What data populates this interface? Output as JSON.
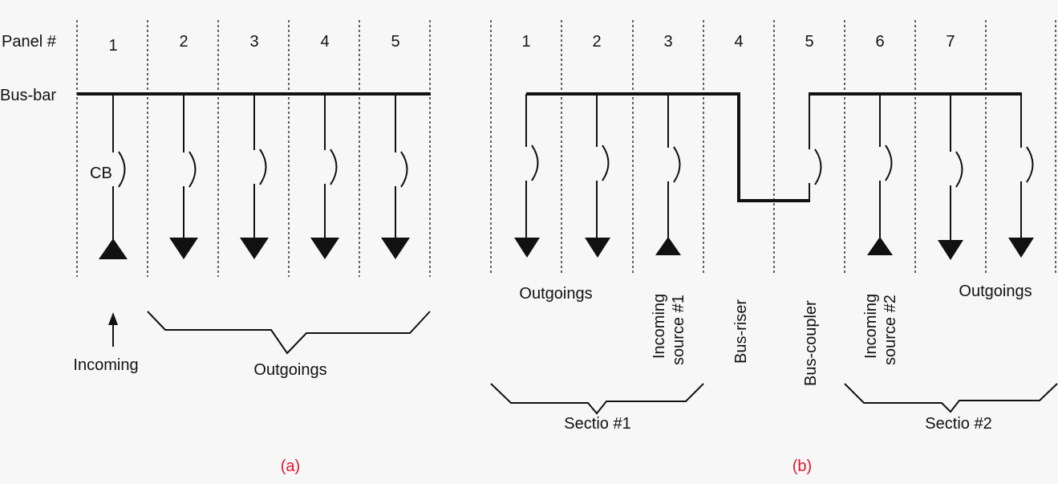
{
  "colors": {
    "ink": "#111111",
    "caption": "#e8132b",
    "background": "#f7f7f7"
  },
  "diagram_a": {
    "caption": "(a)",
    "row_label_panel": "Panel #",
    "row_label_busbar": "Bus-bar",
    "panels": [
      {
        "number": "1",
        "direction": "incoming",
        "cb_label": "CB"
      },
      {
        "number": "2",
        "direction": "outgoing",
        "cb_label": ""
      },
      {
        "number": "3",
        "direction": "outgoing",
        "cb_label": ""
      },
      {
        "number": "4",
        "direction": "outgoing",
        "cb_label": ""
      },
      {
        "number": "5",
        "direction": "outgoing",
        "cb_label": ""
      }
    ],
    "incoming_label": "Incoming",
    "outgoings_label": "Outgoings"
  },
  "diagram_b": {
    "caption": "(b)",
    "panels": [
      {
        "number": "1",
        "type": "outgoing"
      },
      {
        "number": "2",
        "type": "outgoing"
      },
      {
        "number": "3",
        "type": "incoming"
      },
      {
        "number": "4",
        "type": "bus-riser"
      },
      {
        "number": "5",
        "type": "bus-coupler"
      },
      {
        "number": "6",
        "type": "incoming"
      },
      {
        "number": "7",
        "type": "outgoing"
      }
    ],
    "labels": {
      "outgoings_left": "Outgoings",
      "incoming1_line1": "Incoming",
      "incoming1_line2": "source  #1",
      "bus_riser": "Bus-riser",
      "bus_coupler": "Bus-coupler",
      "incoming2_line1": "Incoming",
      "incoming2_line2": "source  #2",
      "outgoings_right": "Outgoings",
      "section1": "Sectio #1",
      "section2": "Sectio #2"
    }
  }
}
